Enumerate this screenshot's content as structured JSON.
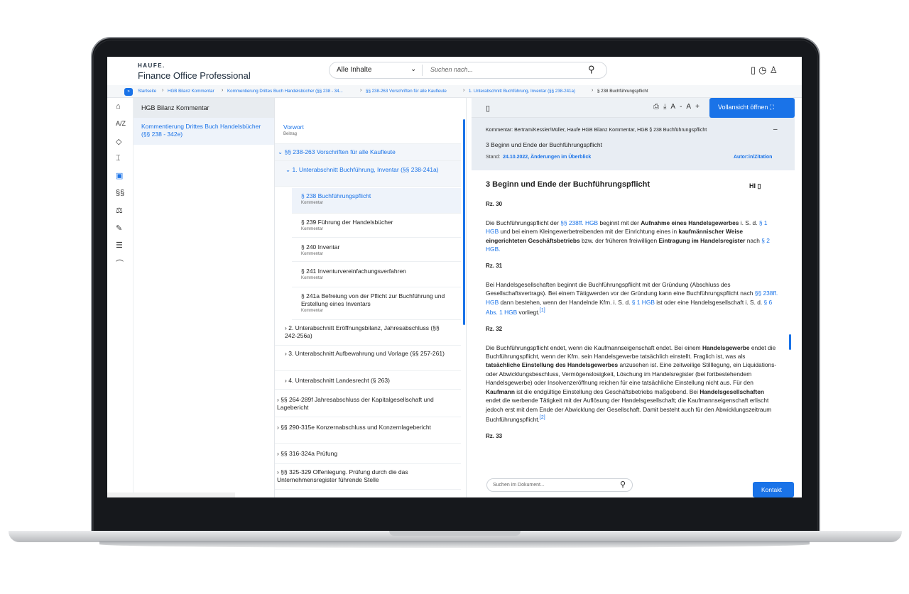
{
  "header": {
    "logo": "HAUFE.",
    "app_name": "Finance Office Professional",
    "search": {
      "filter": "Alle Inhalte",
      "placeholder": "Suchen nach..."
    }
  },
  "breadcrumbs": [
    "Startseite",
    "HGB Bilanz Kommentar",
    "Kommentierung Drittes Buch Handelsbücher (§§ 238 - 34...",
    "§§ 238-263 Vorschriften für alle Kaufleute",
    "1. Unterabschnitt Buchführung, Inventar (§§ 238-241a)",
    "§ 238 Buchführungspflicht"
  ],
  "rail_icons": [
    "home-icon",
    "az-icon",
    "tag-icon",
    "bank-icon",
    "id-card-icon",
    "paragraph-icon",
    "scale-icon",
    "edit-doc-icon",
    "list-icon",
    "graduation-icon"
  ],
  "col1": {
    "title": "HGB Bilanz Kommentar",
    "item": "Kommentierung Drittes Buch Handelsbücher (§§ 238 - 342e)"
  },
  "col2": {
    "items": [
      {
        "label": "Vorwort",
        "sub": "Beitrag"
      },
      {
        "label": "§§ 238-263 Vorschriften für alle Kaufleute"
      },
      {
        "label": "1. Unterabschnitt Buchführung, Inventar (§§ 238-241a)"
      },
      {
        "label": "§ 238 Buchführungspflicht",
        "sub": "Kommentar"
      },
      {
        "label": "§ 239 Führung der Handelsbücher",
        "sub": "Kommentar"
      },
      {
        "label": "§ 240 Inventar",
        "sub": "Kommentar"
      },
      {
        "label": "§ 241 Inventurvereinfachungsverfahren",
        "sub": "Kommentar"
      },
      {
        "label": "§ 241a Befreiung von der Pflicht zur Buchführung und Erstellung eines Inventars",
        "sub": "Kommentar"
      },
      {
        "label": "2. Unterabschnitt Eröffnungsbilanz, Jahresabschluss (§§ 242-256a)"
      },
      {
        "label": "3. Unterabschnitt Aufbewahrung und Vorlage (§§ 257-261)"
      },
      {
        "label": "4. Unterabschnitt Landesrecht (§ 263)"
      },
      {
        "label": "§§ 264-289f Jahresabschluss der Kapitalgesellschaft und Lagebericht"
      },
      {
        "label": "§§ 290-315e Konzernabschluss und Konzernlagebericht"
      },
      {
        "label": "§§ 316-324a Prüfung"
      },
      {
        "label": "§§ 325-329 Offenlegung. Prüfung durch die das Unternehmensregister führende Stelle"
      }
    ]
  },
  "col3": {
    "full_view_label": "Vollansicht öffnen",
    "meta_line": "Kommentar: Bertram/Kessler/Müller, Haufe HGB Bilanz Kommentar, HGB § 238 Buchführungspflicht",
    "meta_title": "3 Beginn und Ende der Buchführungspflicht",
    "stand_label": "Stand:",
    "stand_value": "24.10.2022, Änderungen im Überblick",
    "author_link": "Autor:in/Zitation",
    "doc_heading": "3 Beginn und Ende der Buchführungspflicht",
    "hl": "HI",
    "rz": [
      "Rz. 30",
      "Rz. 31",
      "Rz. 32",
      "Rz. 33"
    ],
    "doc_search_placeholder": "Suchen im Dokument...",
    "kontakt": "Kontakt"
  }
}
